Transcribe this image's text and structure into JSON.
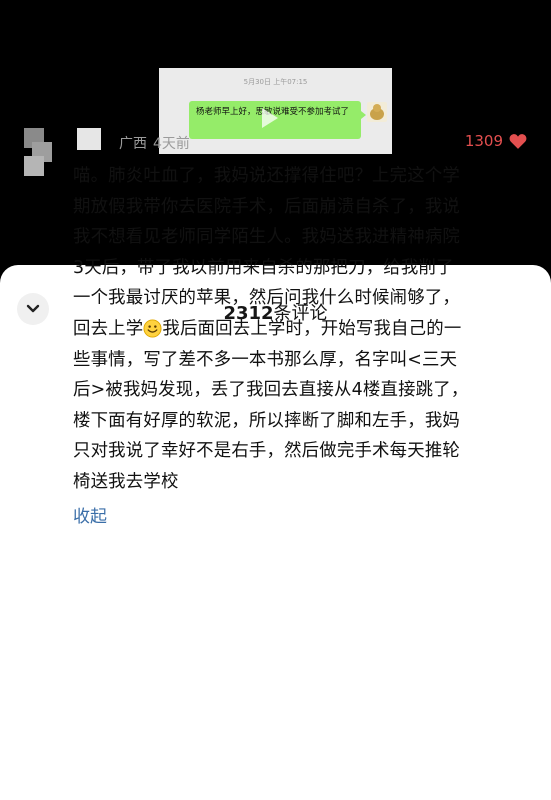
{
  "video": {
    "chat_time": "5月30日 上午07:15",
    "chat_message": "杨老师早上好，思敏说难受不参加考试了",
    "icons": [
      "play-icon",
      "chat-avatar"
    ]
  },
  "comments_panel": {
    "count_number": "2312",
    "count_suffix": "条评论",
    "collapse_icon": "chevron-down-icon"
  },
  "comment": {
    "location": "广西",
    "time_ago": "4天前",
    "likes": "1309",
    "like_icon": "heart-icon",
    "like_color": "#e34f4f",
    "lines": [
      "喵。肺炎吐血了，我妈说还撑得住吧？上完这个学",
      "期放假我带你去医院手术，后面崩溃自杀了，我说",
      "我不想看见老师同学陌生人。我妈送我进精神病院",
      "3天后，带了我以前用来自杀的那把刀，给我削了",
      "一个我最讨厌的苹果，然后问我什么时候闹够了，"
    ],
    "line6_before": "回去上学",
    "line6_after": "我后面回去上学时，开始写我自己的一",
    "lines_rest": [
      "些事情，写了差不多一本书那么厚，名字叫<三天",
      "后>被我妈发现，丢了我回去直接从4楼直接跳了，",
      "楼下面有好厚的软泥，所以摔断了脚和左手，我妈",
      "只对我说了幸好不是右手，然后做完手术每天推轮",
      "椅送我去学校"
    ],
    "emoji": "smile-icon",
    "collapse_label": "收起"
  }
}
